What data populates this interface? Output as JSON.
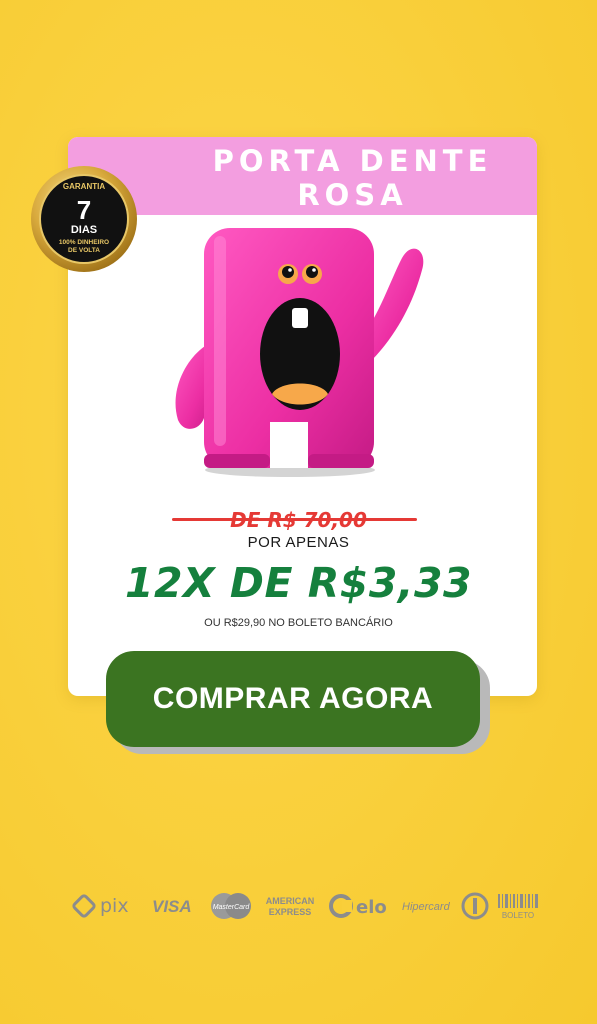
{
  "product": {
    "title_line1": "PORTA DENTE",
    "title_line2": "ROSA",
    "image_icon": "pink-monster-tooth-box-icon"
  },
  "guarantee_badge": {
    "top_text": "GARANTIA",
    "number": "7",
    "unit": "DIAS",
    "line1": "100% DINHEIRO",
    "line2": "DE VOLTA"
  },
  "pricing": {
    "old_price": "DE R$ 70,00",
    "label": "POR APENAS",
    "installments": "12X DE R$3,33",
    "boleto_note": "OU R$29,90 NO BOLETO BANCÁRIO"
  },
  "cta": {
    "label": "COMPRAR AGORA"
  },
  "payment_methods": {
    "pix": "pix",
    "visa": "VISA",
    "mastercard": "MasterCard",
    "amex_line1": "AMERICAN",
    "amex_line2": "EXPRESS",
    "elo": "elo",
    "hipercard": "Hipercard",
    "boleto": "BOLETO"
  },
  "colors": {
    "background": "#f9cf3a",
    "header_pink": "#f39ee0",
    "price_green": "#15803d",
    "old_price_red": "#e53935",
    "button_green": "#3b7421",
    "product_pink": "#ec2ea3"
  }
}
